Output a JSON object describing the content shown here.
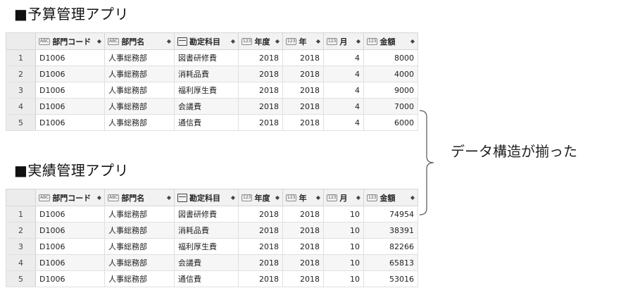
{
  "budget": {
    "title": "■予算管理アプリ",
    "columns": [
      {
        "label": "部門コード",
        "type": "ABC"
      },
      {
        "label": "部門名",
        "type": "ABC"
      },
      {
        "label": "勘定科目",
        "type": "list"
      },
      {
        "label": "年度",
        "type": "123"
      },
      {
        "label": "年",
        "type": "123"
      },
      {
        "label": "月",
        "type": "123"
      },
      {
        "label": "金額",
        "type": "123"
      }
    ],
    "rows": [
      [
        "1",
        "D1006",
        "人事総務部",
        "図書研修費",
        "2018",
        "2018",
        "4",
        "8000"
      ],
      [
        "2",
        "D1006",
        "人事総務部",
        "消耗品費",
        "2018",
        "2018",
        "4",
        "4000"
      ],
      [
        "3",
        "D1006",
        "人事総務部",
        "福利厚生費",
        "2018",
        "2018",
        "4",
        "9000"
      ],
      [
        "4",
        "D1006",
        "人事総務部",
        "会議費",
        "2018",
        "2018",
        "4",
        "7000"
      ],
      [
        "5",
        "D1006",
        "人事総務部",
        "通信費",
        "2018",
        "2018",
        "4",
        "6000"
      ]
    ]
  },
  "actual": {
    "title": "■実績管理アプリ",
    "columns": [
      {
        "label": "部門コード",
        "type": "ABC"
      },
      {
        "label": "部門名",
        "type": "ABC"
      },
      {
        "label": "勘定科目",
        "type": "list"
      },
      {
        "label": "年度",
        "type": "123"
      },
      {
        "label": "年",
        "type": "123"
      },
      {
        "label": "月",
        "type": "123"
      },
      {
        "label": "金額",
        "type": "123"
      }
    ],
    "rows": [
      [
        "1",
        "D1006",
        "人事総務部",
        "図書研修費",
        "2018",
        "2018",
        "10",
        "74954"
      ],
      [
        "2",
        "D1006",
        "人事総務部",
        "消耗品費",
        "2018",
        "2018",
        "10",
        "38391"
      ],
      [
        "3",
        "D1006",
        "人事総務部",
        "福利厚生費",
        "2018",
        "2018",
        "10",
        "82266"
      ],
      [
        "4",
        "D1006",
        "人事総務部",
        "会議費",
        "2018",
        "2018",
        "10",
        "65813"
      ],
      [
        "5",
        "D1006",
        "人事総務部",
        "通信費",
        "2018",
        "2018",
        "10",
        "53016"
      ]
    ]
  },
  "annotation": "データ構造が揃った",
  "sort_glyph": "◆"
}
